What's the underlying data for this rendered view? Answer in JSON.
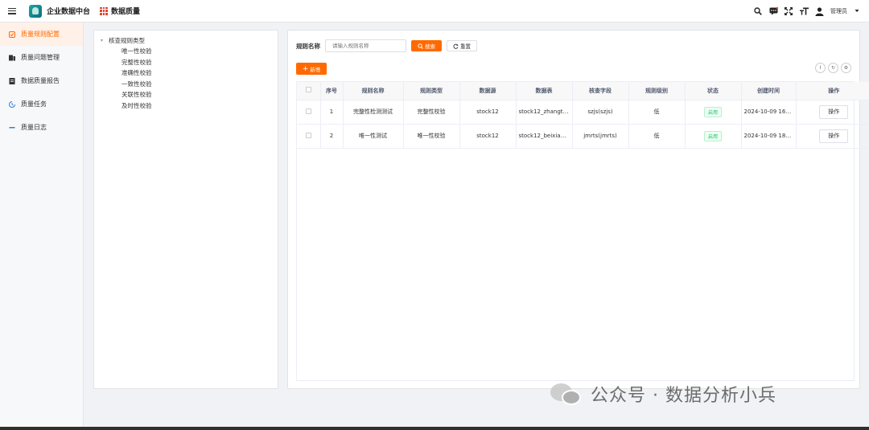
{
  "header": {
    "app_title": "企业数据中台",
    "module_title": "数据质量",
    "user_name": "管理员",
    "icons": [
      "menu-icon",
      "search-icon",
      "message-icon",
      "fullscreen-icon",
      "font-size-icon",
      "user-icon",
      "caret-down-icon"
    ]
  },
  "sidebar": {
    "items": [
      {
        "label": "质量规则配置",
        "icon": "check-square-icon",
        "active": true
      },
      {
        "label": "质量问题管理",
        "icon": "issue-icon",
        "active": false
      },
      {
        "label": "数据质量报告",
        "icon": "report-icon",
        "active": false
      },
      {
        "label": "质量任务",
        "icon": "task-icon",
        "active": false
      },
      {
        "label": "质量日志",
        "icon": "log-icon",
        "active": false
      }
    ]
  },
  "tree": {
    "root": "核查规则类型",
    "children": [
      "唯一性校验",
      "完整性校验",
      "准确性校验",
      "一致性校验",
      "关联性校验",
      "及时性校验"
    ]
  },
  "search": {
    "label": "规则名称",
    "placeholder": "请输入规则名称",
    "search_button": "搜索",
    "reset_button": "重置",
    "add_button": "新增"
  },
  "table": {
    "headers": [
      "序号",
      "规则名称",
      "规则类型",
      "数据源",
      "数据表",
      "核查字段",
      "规则级别",
      "状态",
      "创建时间",
      "操作"
    ],
    "rows": [
      {
        "index": "1",
        "name": "完整性检测测试",
        "type": "完整性校验",
        "source": "stock12",
        "table": "stock12_zhangti...",
        "field": "szjs(szjs)",
        "level": "低",
        "status": "启用",
        "created": "2024-10-09 16:4...",
        "action": "操作"
      },
      {
        "index": "2",
        "name": "唯一性测试",
        "type": "唯一性校验",
        "source": "stock12",
        "table": "stock12_beixian...",
        "field": "jmrts(jmrts)",
        "level": "低",
        "status": "启用",
        "created": "2024-10-09 18:4...",
        "action": "操作"
      }
    ]
  },
  "watermark": {
    "text": "公众号 · 数据分析小兵"
  },
  "colors": {
    "accent": "#ff6a00",
    "status_green": "#19be6b",
    "sidebar_active_bg": "#fff1e8"
  }
}
